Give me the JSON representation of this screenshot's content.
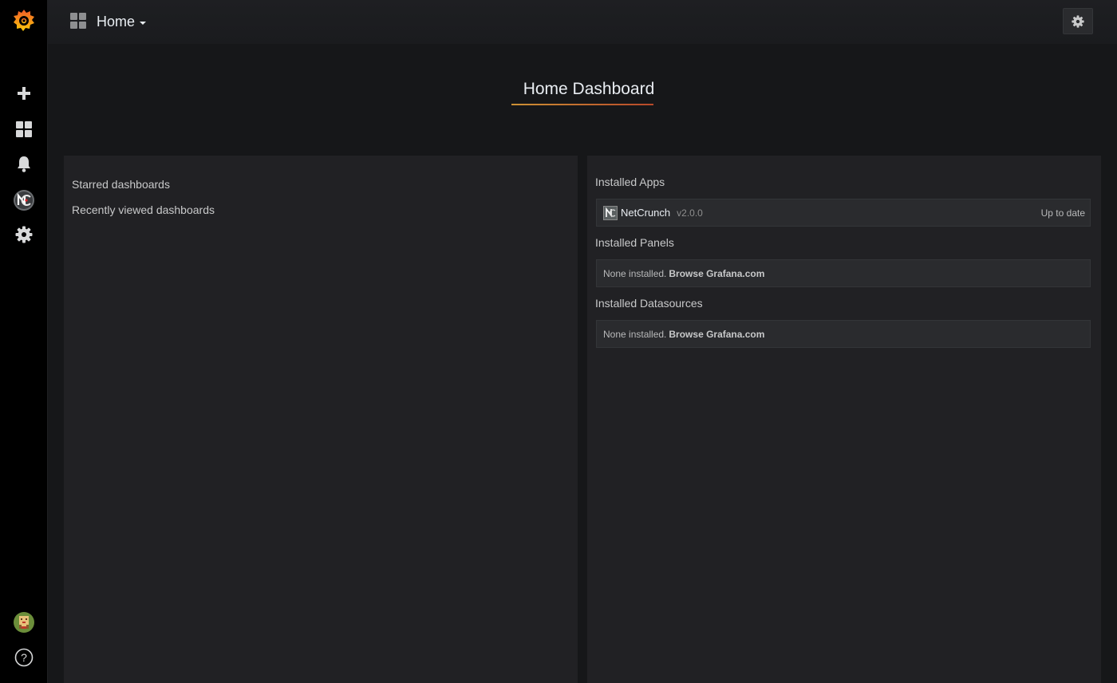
{
  "app": {
    "brand": "grafana-logo"
  },
  "sidemenu": {
    "items": [
      {
        "name": "create",
        "icon": "plus-icon"
      },
      {
        "name": "dashboards",
        "icon": "grid-icon"
      },
      {
        "name": "alerting",
        "icon": "bell-icon"
      },
      {
        "name": "netcrunch",
        "icon": "netcrunch-icon"
      },
      {
        "name": "configuration",
        "icon": "gear-icon"
      }
    ],
    "bottom": [
      {
        "name": "profile",
        "icon": "avatar-icon"
      },
      {
        "name": "help",
        "icon": "help-icon"
      }
    ]
  },
  "navbar": {
    "title": "Home",
    "settings_icon": "gear-icon"
  },
  "page": {
    "title": "Home Dashboard"
  },
  "left_panel": {
    "starred": "Starred dashboards",
    "recent": "Recently viewed dashboards"
  },
  "right_panel": {
    "apps_title": "Installed Apps",
    "apps": [
      {
        "name": "NetCrunch",
        "version": "v2.0.0",
        "status": "Up to date"
      }
    ],
    "panels_title": "Installed Panels",
    "panels_none": "None installed.",
    "panels_browse": "Browse Grafana.com",
    "datasources_title": "Installed Datasources",
    "datasources_none": "None installed.",
    "datasources_browse": "Browse Grafana.com"
  },
  "colors": {
    "accent_start": "#fbb03b",
    "accent_end": "#e0552e",
    "background": "#161719",
    "panel": "#212124"
  }
}
